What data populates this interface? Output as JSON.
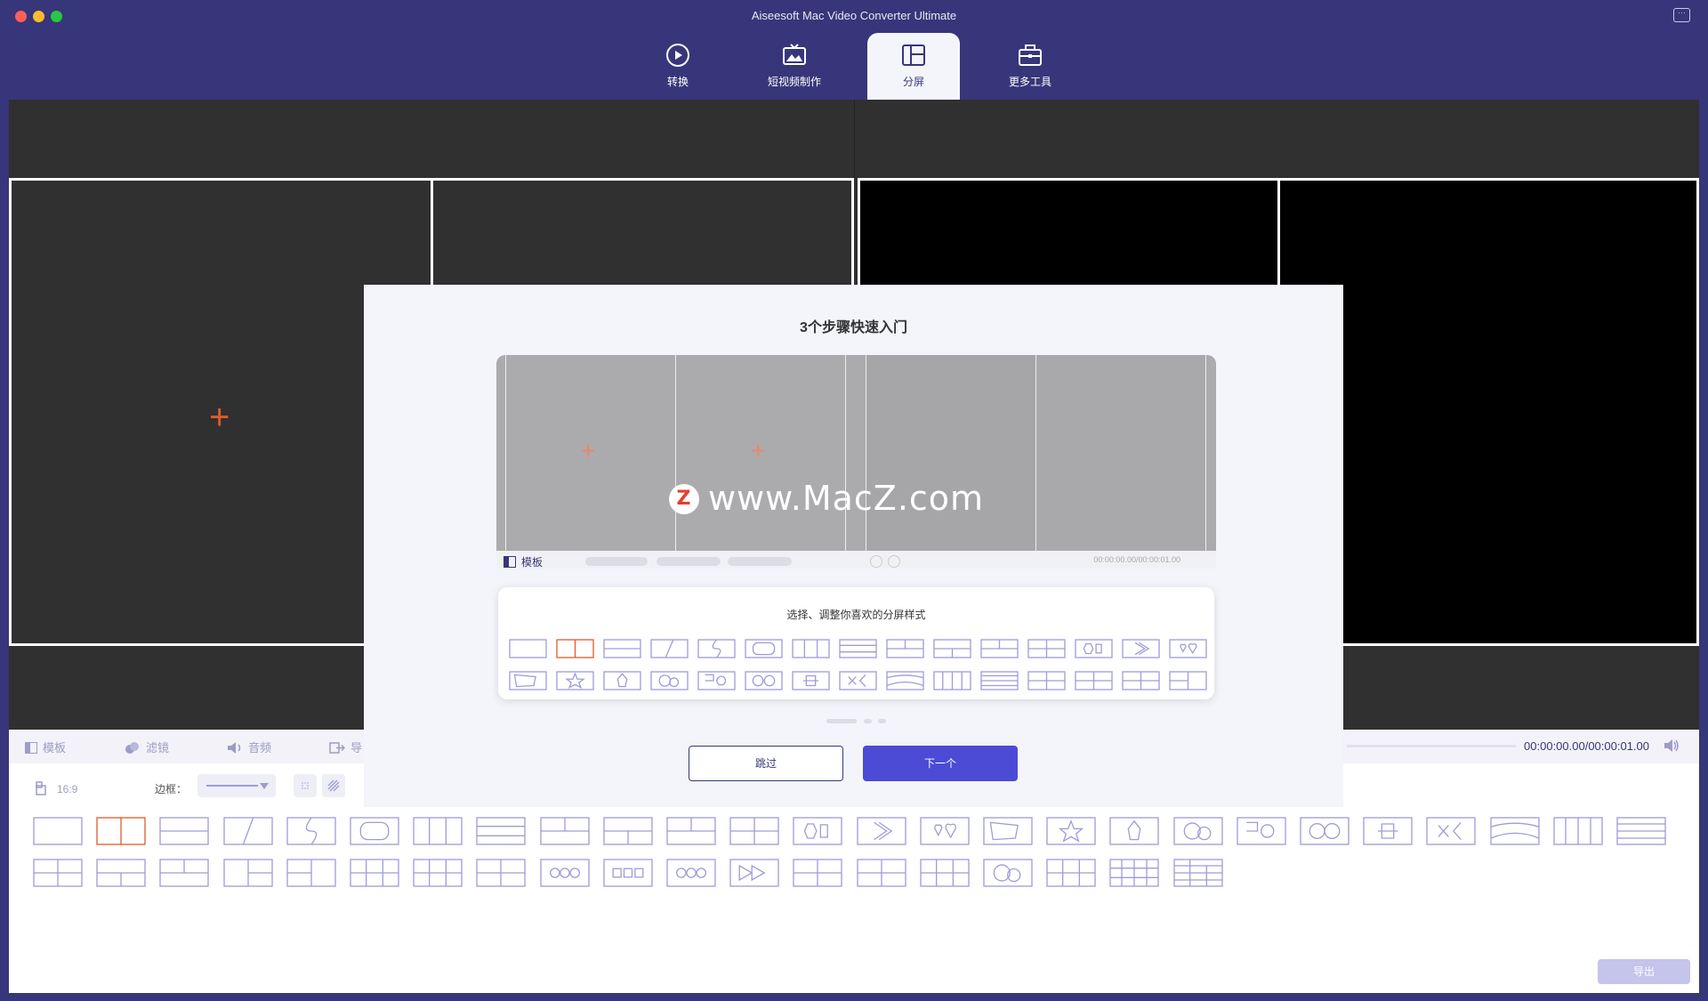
{
  "window": {
    "title": "Aiseesoft Mac Video Converter Ultimate"
  },
  "nav": [
    {
      "label": "转换",
      "icon": "convert-icon",
      "active": false
    },
    {
      "label": "短视频制作",
      "icon": "mv-icon",
      "active": false
    },
    {
      "label": "分屏",
      "icon": "collage-icon",
      "active": true
    },
    {
      "label": "更多工具",
      "icon": "toolbox-icon",
      "active": false
    }
  ],
  "bottom": {
    "tabs": {
      "template": "模板",
      "filter": "滤镜",
      "audio": "音频",
      "export": "导"
    },
    "time": "00:00:00.00/00:00:01.00",
    "ratio": "16:9",
    "border_label": "边框：",
    "export_button": "导出"
  },
  "overlay": {
    "title": "3个步骤快速入门",
    "demo_tab": "模板",
    "demo_time": "00:00:00.00/00:00:01.00",
    "watermark": "www.MacZ.com",
    "watermark_logo": "Z",
    "panel_title": "选择、调整你喜欢的分屏样式",
    "skip_button": "跳过",
    "next_button": "下一个"
  },
  "colors": {
    "accent": "#4b4bd6",
    "nav_bg": "#37367a",
    "selected": "#e05a2d",
    "template_stroke": "#9d9cd9"
  }
}
